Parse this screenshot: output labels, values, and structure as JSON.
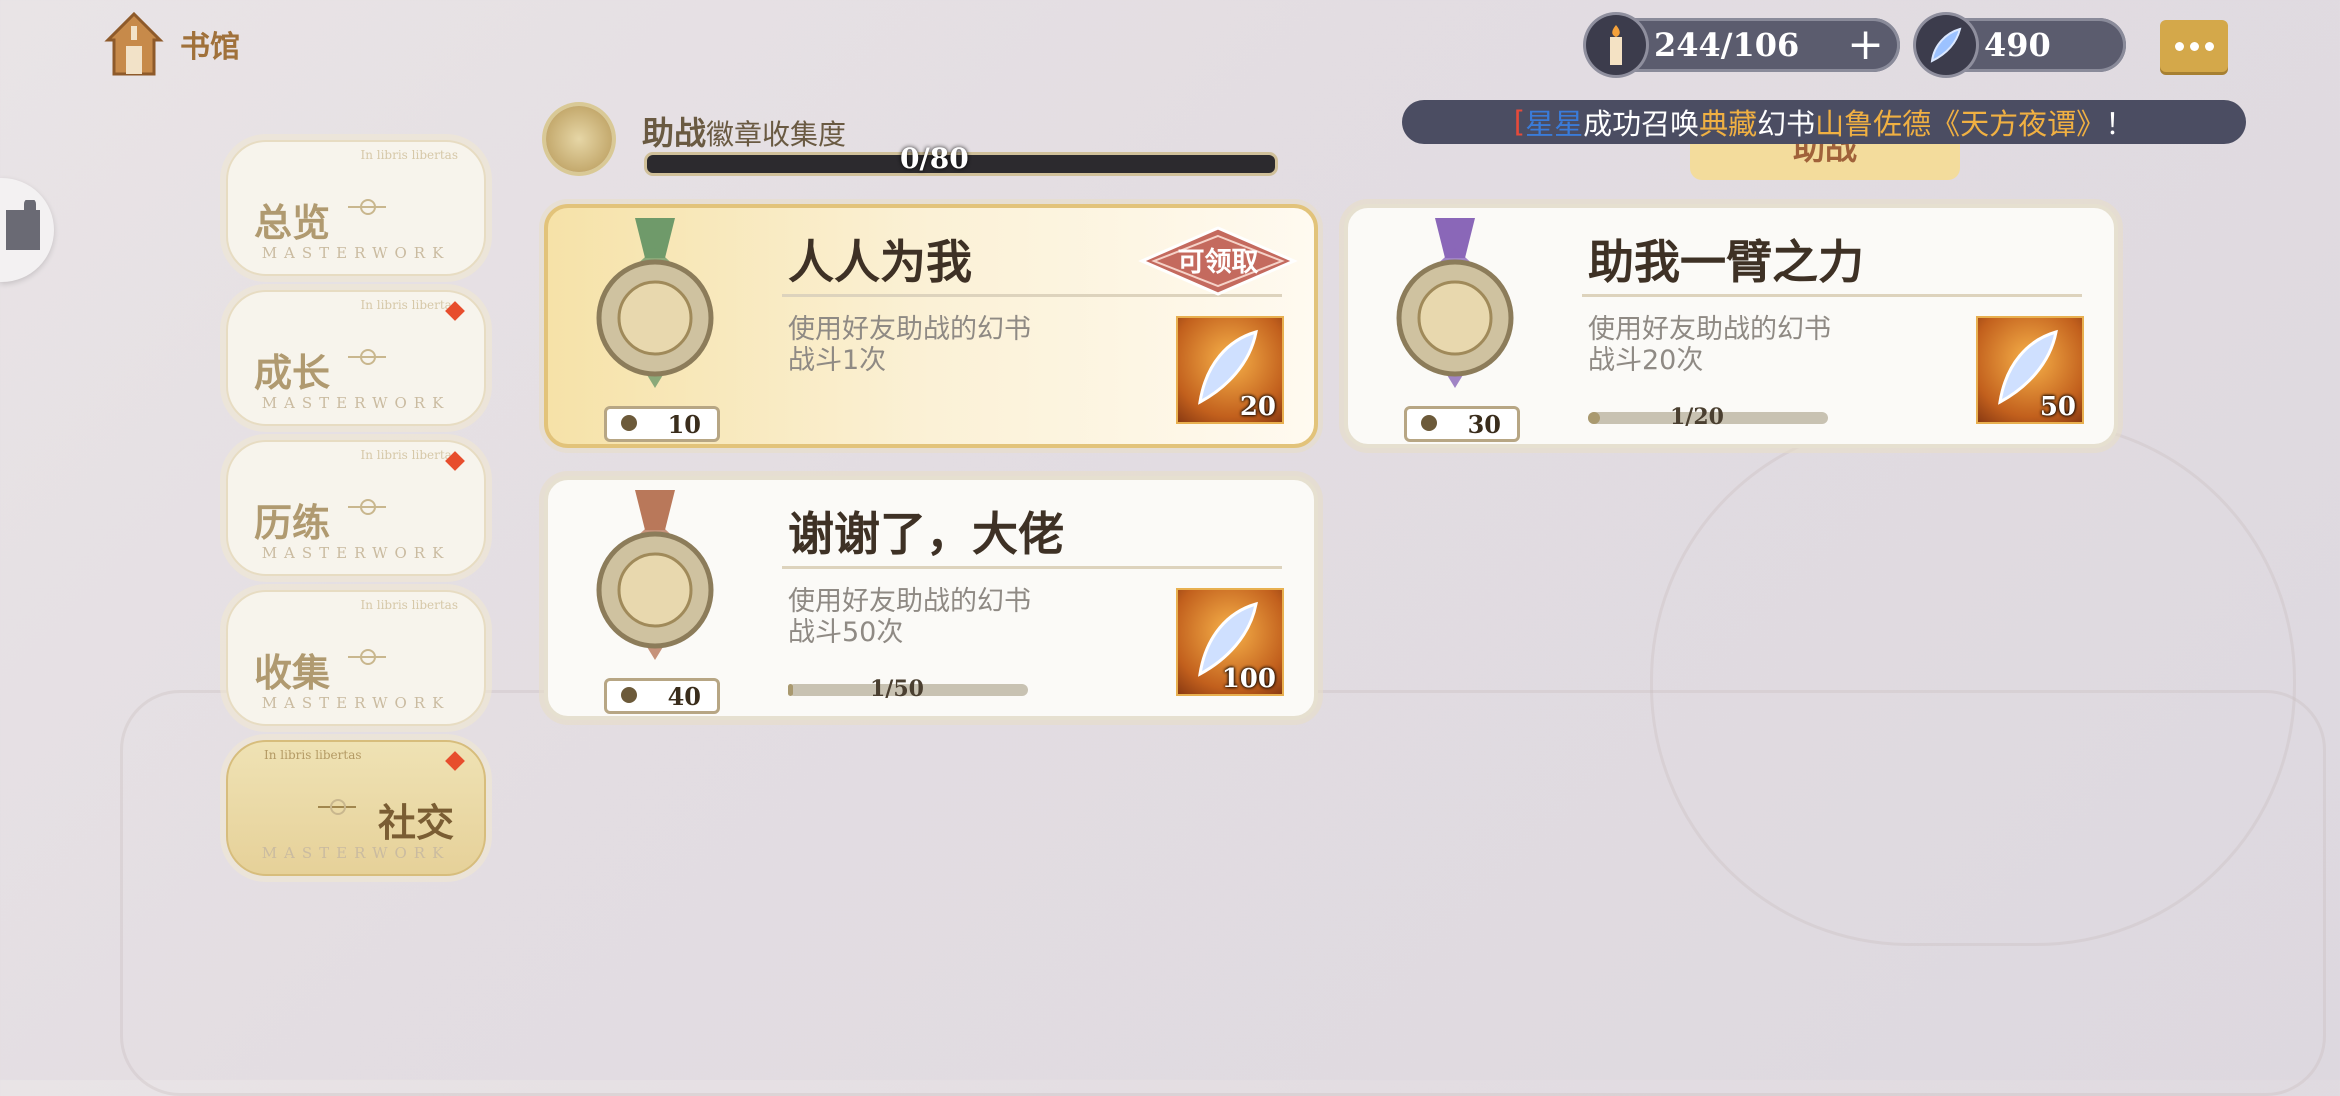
{
  "header": {
    "home_label": "书馆",
    "candle_value": "244/106",
    "gem_value": "490"
  },
  "marquee": {
    "part1": "[",
    "part2": "星星",
    "part3": "成功召唤",
    "part4": "典藏",
    "part5": "幻书",
    "part6": "山鲁佐德《天方夜谭》",
    "part7": "！"
  },
  "top_tab": "助战",
  "nav": [
    {
      "label": "总览",
      "sub": "MASTERWORK",
      "motto": "In libris libertas"
    },
    {
      "label": "成长",
      "sub": "MASTERWORK",
      "motto": "In libris libertas"
    },
    {
      "label": "历练",
      "sub": "MASTERWORK",
      "motto": "In libris libertas"
    },
    {
      "label": "收集",
      "sub": "MASTERWORK",
      "motto": "In libris libertas"
    },
    {
      "label": "社交",
      "sub": "MASTERWORK",
      "motto": "In libris libertas"
    }
  ],
  "collection": {
    "title": "助战",
    "subtitle": "徽章收集度",
    "progress_text": "0/80",
    "progress_fraction": 0.0
  },
  "cards": [
    {
      "title": "人人为我",
      "desc": "使用好友助战的幻书战斗1次",
      "points": "10",
      "reward_qty": "20",
      "stamp": "可领取",
      "medal_color": "#6f9a6a"
    },
    {
      "title": "助我一臂之力",
      "desc": "使用好友助战的幻书战斗20次",
      "points": "30",
      "reward_qty": "50",
      "progress_text": "1/20",
      "progress_fraction": 0.05,
      "medal_color": "#8a67b8"
    },
    {
      "title": "谢谢了，大佬",
      "desc": "使用好友助战的幻书战斗50次",
      "points": "40",
      "reward_qty": "100",
      "progress_text": "1/50",
      "progress_fraction": 0.02,
      "medal_color": "#b9785a"
    }
  ],
  "colors": {
    "accent_gold": "#d4a84a",
    "badge_red": "#e74d2d",
    "text_dark": "#3e3125"
  }
}
